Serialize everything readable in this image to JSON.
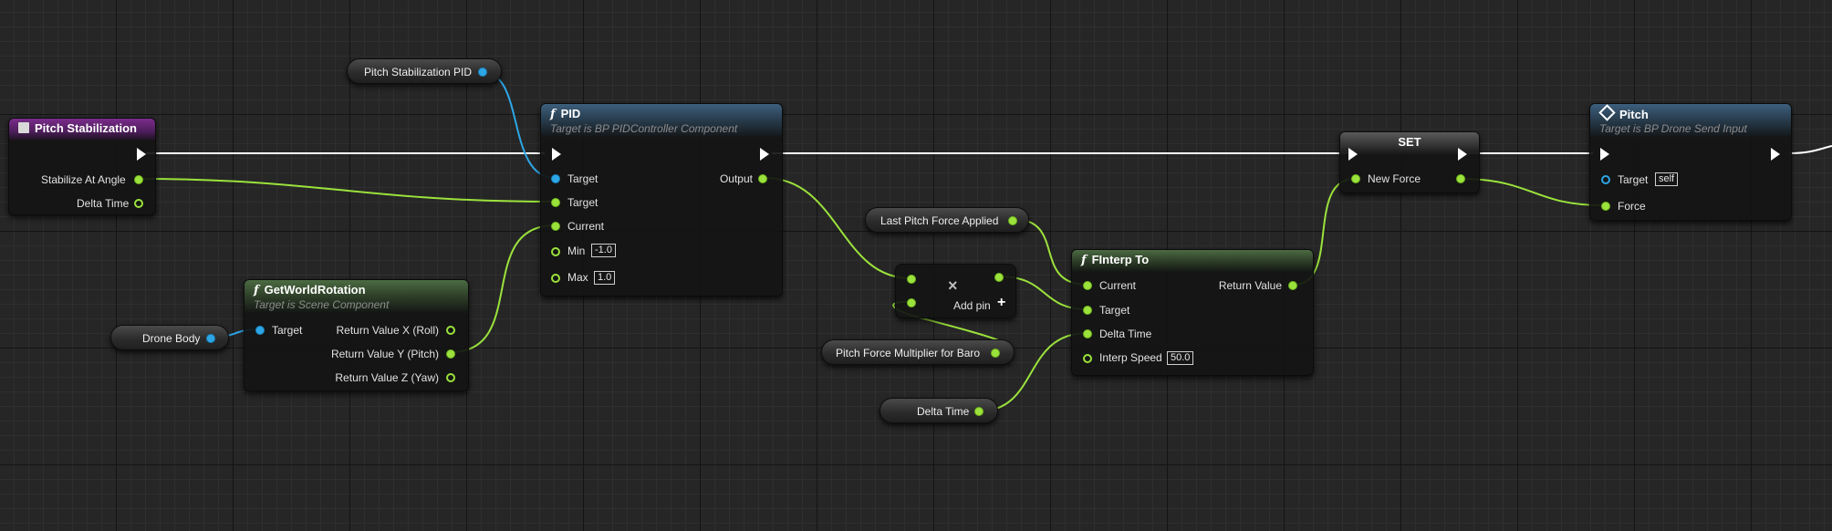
{
  "variables": {
    "pitch_stab_pid": "Pitch Stabilization PID",
    "drone_body": "Drone Body",
    "last_pitch_force": "Last Pitch Force Applied",
    "pitch_force_mult": "Pitch Force Multiplier for Baro",
    "delta_time": "Delta Time"
  },
  "event_node": {
    "title": "Pitch Stabilization",
    "pin_stabilize": "Stabilize At Angle",
    "pin_delta": "Delta Time"
  },
  "rotation_node": {
    "icon": "function-icon",
    "title": "GetWorldRotation",
    "subtitle": "Target is Scene Component",
    "pin_target": "Target",
    "pin_roll": "Return Value X (Roll)",
    "pin_pitch": "Return Value Y (Pitch)",
    "pin_yaw": "Return Value Z (Yaw)"
  },
  "pid_node": {
    "icon": "function-icon",
    "title": "PID",
    "subtitle": "Target is BP PIDController Component",
    "pin_target_obj": "Target",
    "pin_target": "Target",
    "pin_current": "Current",
    "pin_min": "Min",
    "min_value": "-1.0",
    "pin_max": "Max",
    "max_value": "1.0",
    "pin_output": "Output"
  },
  "multiply_node": {
    "symbol": "×",
    "add_pin": "Add pin",
    "add_symbol": "+"
  },
  "finterp_node": {
    "icon": "function-icon",
    "title": "FInterp To",
    "pin_current": "Current",
    "pin_target": "Target",
    "pin_delta": "Delta Time",
    "pin_speed": "Interp Speed",
    "speed_value": "50.0",
    "pin_return": "Return Value"
  },
  "set_node": {
    "title": "SET",
    "pin_new_force": "New Force"
  },
  "pitch_node": {
    "icon": "diamond-icon",
    "title": "Pitch",
    "subtitle": "Target is BP Drone Send Input",
    "pin_target": "Target",
    "target_value": "self",
    "pin_force": "Force"
  },
  "colors": {
    "background": "#262626",
    "float_pin": "#9be23c",
    "object_pin": "#2da6e6",
    "exec_wire": "#ffffff",
    "function_header": "#3d5f7d",
    "pure_header": "#4b6b42",
    "event_header": "#7a2c8c"
  }
}
